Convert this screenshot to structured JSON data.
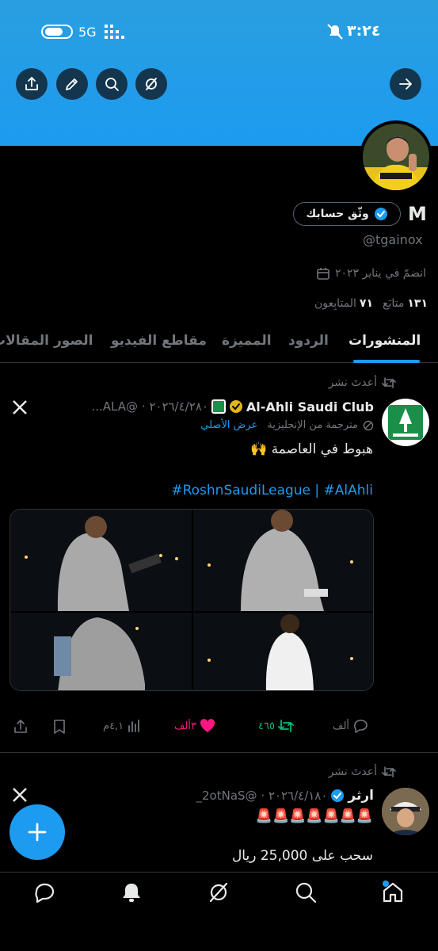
{
  "status": {
    "time": "٣:٢٤",
    "network": "5G"
  },
  "profile": {
    "name": "M",
    "verify_label": "وثّق حسابك",
    "handle": "@tgainox",
    "joined": "انضمّ في يناير ٢٠٢٣",
    "following_count": "١٣١",
    "following_label": "متابَع",
    "followers_count": "٧١",
    "followers_label": "المتابِعون"
  },
  "tabs": [
    "المنشورات",
    "الردود",
    "المميزة",
    "مقاطع الفيديو",
    "الصور",
    "المقالات"
  ],
  "posts": [
    {
      "repost_label": "أعدتَ نشر",
      "author": "Al-Ahli Saudi Club",
      "handle_date": "٢٠٢٦/٤/٢٨٠ · @ALA...",
      "translated_label": "مترجمة من الإنجليزية",
      "show_original": "عرض الأصلي",
      "text": "هبوط في العاصمة 🙌",
      "hashtags": "#RoshnSaudiLeague | #AlAhli",
      "stats": {
        "views": "٤,١م",
        "likes": "٣ألف",
        "reposts": "٤٦٥",
        "replies": "ألف"
      }
    },
    {
      "repost_label": "أعدتَ نشر",
      "author": "ارثر",
      "handle_date": "٢٠٢٦/٤/١٨٠ · @2otNaS_",
      "emojis": "🚨🚨🚨🚨🚨🚨🚨",
      "text": "سحب على 25,000 ريال"
    }
  ],
  "colors": {
    "accent": "#1d9bf0",
    "like": "#f91880",
    "repost": "#00ba7c",
    "header": "#1d9bf0"
  }
}
